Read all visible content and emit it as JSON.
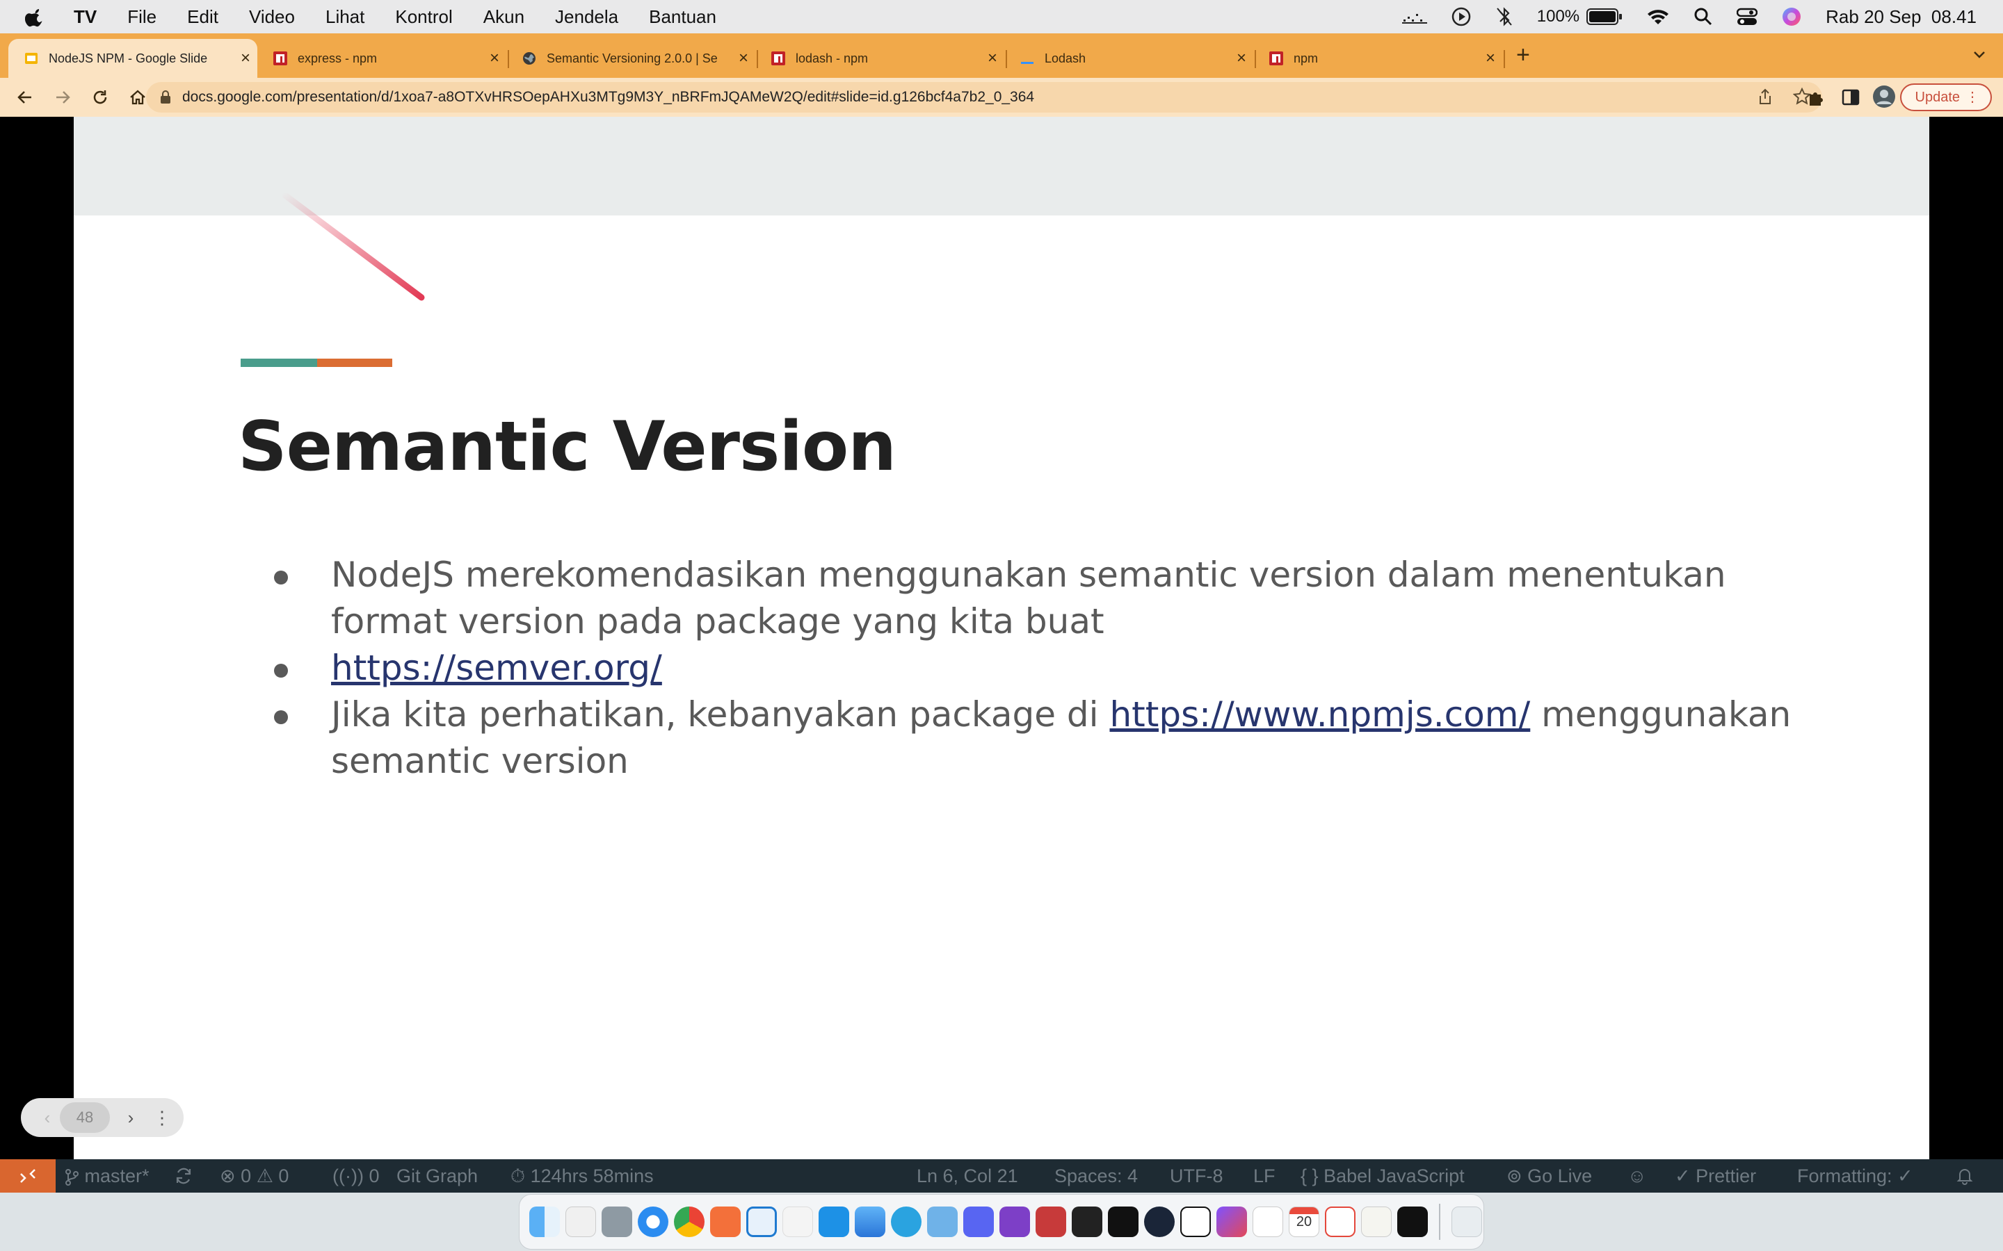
{
  "menubar": {
    "app": "TV",
    "items": [
      "File",
      "Edit",
      "Video",
      "Lihat",
      "Kontrol",
      "Akun",
      "Jendela",
      "Bantuan"
    ],
    "battery": "100%",
    "clock": "Rab 20 Sep  08.41"
  },
  "browser": {
    "tabs": [
      {
        "title": "NodeJS NPM - Google Slide",
        "active": true,
        "favicon": "google-slides-icon"
      },
      {
        "title": "express - npm",
        "active": false,
        "favicon": "npm-icon"
      },
      {
        "title": "Semantic Versioning 2.0.0 | Se",
        "active": false,
        "favicon": "globe-icon"
      },
      {
        "title": "lodash - npm",
        "active": false,
        "favicon": "npm-icon"
      },
      {
        "title": "Lodash",
        "active": false,
        "favicon": "lodash-icon"
      },
      {
        "title": "npm",
        "active": false,
        "favicon": "npm-icon"
      }
    ],
    "url": "docs.google.com/presentation/d/1xoa7-a8OTXvHRSOepAHXu3MTg9M3Y_nBRFmJQAMeW2Q/edit#slide=id.g126bcf4a7b2_0_364",
    "update_label": "Update"
  },
  "slide": {
    "title": "Semantic Version",
    "bullet1": "NodeJS merekomendasikan menggunakan semantic version dalam menentukan format version pada package yang kita buat",
    "bullet2_link": "https://semver.org/",
    "bullet3_pre": "Jika kita perhatikan, kebanyakan package di ",
    "bullet3_link": "https://www.npmjs.com/",
    "bullet3_post": " menggunakan semantic version",
    "page_number": "48",
    "colors": {
      "accent_teal": "#4a9d8c",
      "accent_orange": "#db6d33",
      "link": "#27356e",
      "header_band": "#e9ecec"
    }
  },
  "statusbar": {
    "branch": "master*",
    "errors": "0",
    "warnings": "0",
    "ports": "0",
    "git_graph": "Git Graph",
    "timer": "124hrs 58mins",
    "position": "Ln 6, Col 21",
    "spaces": "Spaces: 4",
    "encoding": "UTF-8",
    "eol": "LF",
    "language": "Babel JavaScript",
    "go_live": "Go Live",
    "prettier": "Prettier",
    "formatting": "Formatting: ✓"
  },
  "dock": {
    "calendar_day": "20"
  }
}
